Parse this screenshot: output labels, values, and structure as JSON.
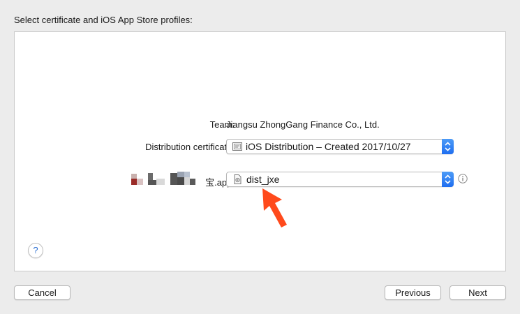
{
  "header": {
    "instruction": "Select certificate and iOS App Store profiles:"
  },
  "form": {
    "team_label": "Team:",
    "team_value": "Jiangsu ZhongGang Finance Co., Ltd.",
    "certificate_label": "Distribution certificate:",
    "certificate_value": "iOS Distribution – Created 2017/10/27",
    "app_label": "宝.app:",
    "profile_value": "dist_jxe"
  },
  "buttons": {
    "help": "?",
    "cancel": "Cancel",
    "previous": "Previous",
    "next": "Next"
  },
  "colors": {
    "accent": "#1f6ef0",
    "annotation_arrow": "#ff4a1c"
  },
  "icons": {
    "certificate": "certificate-icon",
    "profile": "provisioning-profile-icon",
    "info": "info-icon",
    "stepper": "chevron-updown-icon"
  }
}
